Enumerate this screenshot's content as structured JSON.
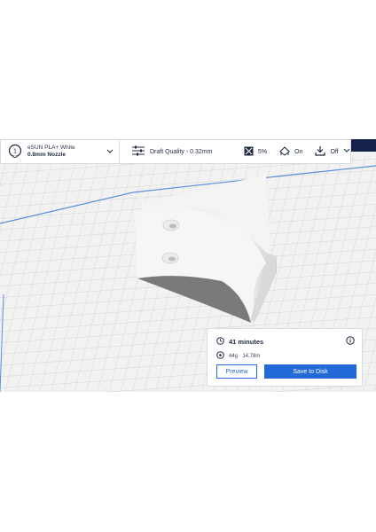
{
  "toolbar": {
    "material_brand": "eSUN PLA+ White",
    "nozzle": "0.8mm Nozzle",
    "extruder_number": "1",
    "quality": "Draft Quality - 0.32mm",
    "infill": "5%",
    "support": "On",
    "adhesion": "Off"
  },
  "print_panel": {
    "time": "41 minutes",
    "material_usage": "44g · 14.78m",
    "preview_label": "Preview",
    "save_label": "Save to Disk"
  },
  "colors": {
    "accent": "#2469d8",
    "build_plate_border": "#5b8fe0",
    "header_dark": "#15214a"
  },
  "icons": [
    "extruder-icon",
    "chevron-down-icon",
    "sliders-icon",
    "infill-icon",
    "support-icon",
    "adhesion-icon",
    "clock-icon",
    "spool-icon",
    "info-icon"
  ]
}
